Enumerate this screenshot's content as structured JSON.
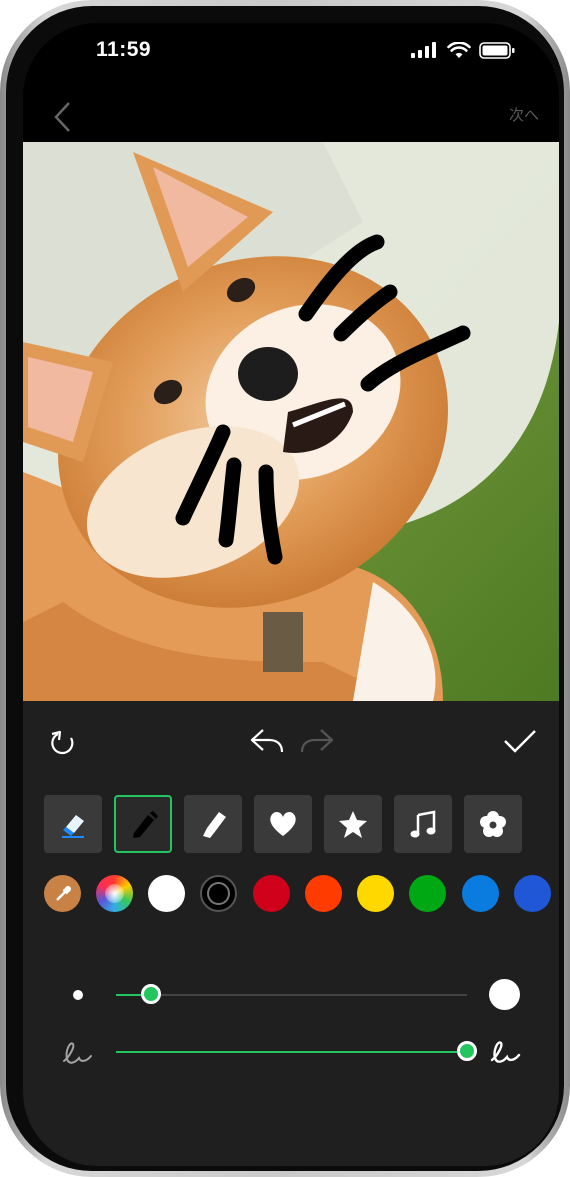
{
  "status_bar": {
    "time": "11:59"
  },
  "nav": {
    "next_label": "次へ",
    "back_icon": "chevron-left-icon"
  },
  "photo": {
    "subject": "shiba-inu-with-cone"
  },
  "editor": {
    "top_actions": [
      "reset-icon",
      "undo-icon",
      "redo-icon",
      "checkmark-icon"
    ],
    "tools": [
      {
        "name": "eraser",
        "icon": "eraser-icon",
        "selected": false
      },
      {
        "name": "pen",
        "icon": "pen-icon",
        "selected": true
      },
      {
        "name": "marker",
        "icon": "marker-icon",
        "selected": false
      },
      {
        "name": "heart",
        "icon": "heart-icon",
        "selected": false
      },
      {
        "name": "star",
        "icon": "star-icon",
        "selected": false
      },
      {
        "name": "music",
        "icon": "music-note-icon",
        "selected": false
      },
      {
        "name": "flower",
        "icon": "flower-icon",
        "selected": false
      }
    ],
    "colors": [
      {
        "name": "eyedropper",
        "color": "#c98245"
      },
      {
        "name": "spectrum",
        "color": "rainbow"
      },
      {
        "name": "white",
        "color": "#ffffff"
      },
      {
        "name": "black",
        "color": "#000000"
      },
      {
        "name": "red",
        "color": "#d0021b"
      },
      {
        "name": "orange-red",
        "color": "#ff3b00"
      },
      {
        "name": "yellow",
        "color": "#ffd800"
      },
      {
        "name": "green",
        "color": "#00a814"
      },
      {
        "name": "blue",
        "color": "#0a7cdf"
      },
      {
        "name": "royal-blue",
        "color": "#1f57d6"
      }
    ],
    "size_slider": {
      "value": 0.1
    },
    "opacity_slider": {
      "value": 1.0
    },
    "accent_color": "#22c55e"
  }
}
